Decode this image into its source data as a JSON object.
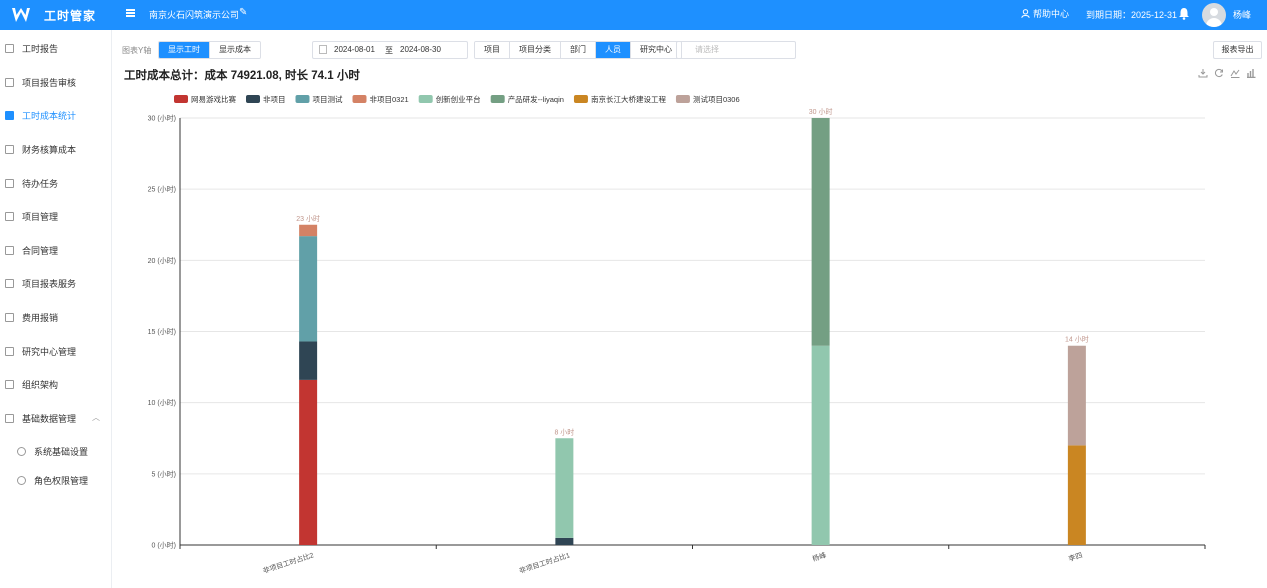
{
  "header": {
    "app_title": "工时管家",
    "company": "南京火石闪筑演示公司",
    "help_label": "帮助中心",
    "expire_label": "到期日期：2025-12-31",
    "username": "杨峰",
    "colors": {
      "brand": "#1e90ff"
    },
    "icons": [
      "logo-w-icon",
      "menu-icon",
      "edit-icon",
      "user-icon",
      "bell-icon",
      "avatar"
    ]
  },
  "sidebar": {
    "items": [
      {
        "label": "工时报告",
        "icon": "doc-icon"
      },
      {
        "label": "项目报告审核",
        "icon": "review-icon"
      },
      {
        "label": "工时成本统计",
        "icon": "chart-icon",
        "active": true
      },
      {
        "label": "财务核算成本",
        "icon": "finance-icon"
      },
      {
        "label": "待办任务",
        "icon": "task-icon"
      },
      {
        "label": "项目管理",
        "icon": "project-icon"
      },
      {
        "label": "合同管理",
        "icon": "contract-icon"
      },
      {
        "label": "项目报表服务",
        "icon": "report-icon"
      },
      {
        "label": "费用报销",
        "icon": "expense-icon"
      },
      {
        "label": "研究中心管理",
        "icon": "research-icon"
      },
      {
        "label": "组织架构",
        "icon": "org-icon"
      },
      {
        "label": "基础数据管理",
        "icon": "data-icon",
        "expanded": true
      }
    ],
    "sub_items": [
      {
        "label": "系统基础设置",
        "icon": "shield-icon"
      },
      {
        "label": "角色权限管理",
        "icon": "user-icon"
      }
    ]
  },
  "toolbar": {
    "y_axis_label": "图表Y轴",
    "y_axis_options": [
      {
        "label": "显示工时",
        "selected": true
      },
      {
        "label": "显示成本",
        "selected": false
      }
    ],
    "date_from": "2024-08-01",
    "date_sep": "至",
    "date_to": "2024-08-30",
    "group_options": [
      {
        "label": "项目",
        "selected": false
      },
      {
        "label": "项目分类",
        "selected": false
      },
      {
        "label": "部门",
        "selected": false
      },
      {
        "label": "人员",
        "selected": true
      },
      {
        "label": "研究中心",
        "selected": false
      }
    ],
    "select_placeholder": "请选择",
    "export_label": "报表导出"
  },
  "summary": "工时成本总计：成本 74921.08, 时长 74.1 小时",
  "chart_tools": [
    "download-icon",
    "refresh-icon",
    "line-chart-icon",
    "bar-chart-icon"
  ],
  "chart_data": {
    "type": "bar",
    "stacked": true,
    "categories": [
      "非项目工时占比2",
      "非项目工时占比1",
      "杨峰",
      "李四"
    ],
    "series": [
      {
        "name": "网易游戏比赛",
        "color": "#c23531",
        "values": [
          11.6,
          0,
          0,
          0
        ]
      },
      {
        "name": "非项目",
        "color": "#2f4554",
        "values": [
          2.7,
          0.5,
          0,
          0
        ]
      },
      {
        "name": "项目测试",
        "color": "#61a0a8",
        "values": [
          7.4,
          0,
          0,
          0
        ]
      },
      {
        "name": "非项目0321",
        "color": "#d48265",
        "values": [
          0.8,
          0,
          0,
          0
        ]
      },
      {
        "name": "创新创业平台",
        "color": "#91c7ae",
        "values": [
          0,
          7,
          14,
          0
        ]
      },
      {
        "name": "产品研发--liyaqin",
        "color": "#749f83",
        "values": [
          0,
          0,
          16,
          0
        ]
      },
      {
        "name": "南京长江大桥建设工程",
        "color": "#ca8622",
        "values": [
          0,
          0,
          0,
          7
        ]
      },
      {
        "name": "测试项目0306",
        "color": "#bda29a",
        "values": [
          0,
          0,
          0,
          7
        ]
      }
    ],
    "totals_labels": [
      "23 小时",
      "8 小时",
      "30 小时",
      "14 小时"
    ],
    "y_ticks": [
      "0 (小时)",
      "5 (小时)",
      "10 (小时)",
      "15 (小时)",
      "20 (小时)",
      "25 (小时)",
      "30 (小时)"
    ],
    "ylim": [
      0,
      30
    ],
    "grid": true,
    "legend_position": "top-left"
  }
}
